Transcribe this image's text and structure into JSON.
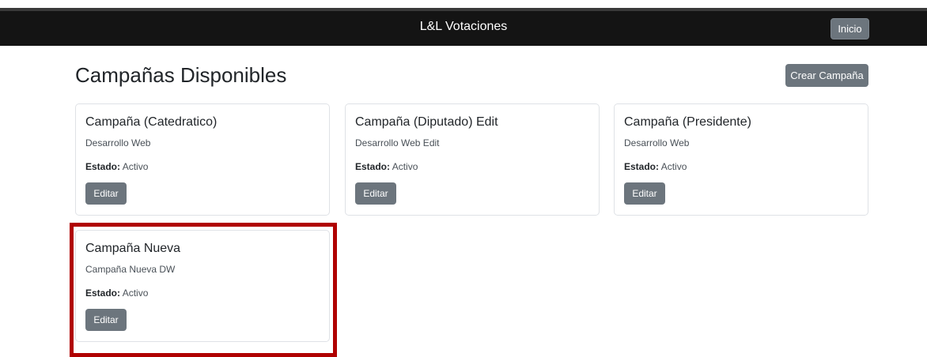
{
  "navbar": {
    "brand": "L&L Votaciones",
    "home_label": "Inicio"
  },
  "main": {
    "title": "Campañas Disponibles",
    "create_label": "Crear Campaña",
    "status_label": "Estado:",
    "campaigns": [
      {
        "title": "Campaña (Catedratico)",
        "description": "Desarrollo Web",
        "status": "Activo",
        "edit_label": "Editar"
      },
      {
        "title": "Campaña (Diputado) Edit",
        "description": "Desarrollo Web Edit",
        "status": "Activo",
        "edit_label": "Editar"
      },
      {
        "title": "Campaña (Presidente)",
        "description": "Desarrollo Web",
        "status": "Activo",
        "edit_label": "Editar"
      },
      {
        "title": "Campaña Nueva",
        "description": "Campaña Nueva DW",
        "status": "Activo",
        "edit_label": "Editar"
      }
    ]
  },
  "colors": {
    "navbar_bg": "#141414",
    "button_bg": "#6c757d",
    "highlight": "#b00000"
  }
}
